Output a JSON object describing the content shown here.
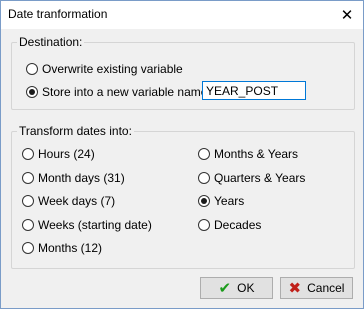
{
  "window": {
    "title": "Date tranformation"
  },
  "destination": {
    "legend": "Destination:",
    "overwrite_label": "Overwrite existing variable",
    "store_new_label": "Store into a new variable named:",
    "new_variable_value": "YEAR_POST",
    "selected": "store_new"
  },
  "transform": {
    "legend": "Transform dates into:",
    "left_options": [
      "Hours (24)",
      "Month days (31)",
      "Week days (7)",
      "Weeks (starting date)",
      "Months (12)"
    ],
    "right_options": [
      "Months & Years",
      "Quarters & Years",
      "Years",
      "Decades"
    ],
    "selected": "Years"
  },
  "buttons": {
    "ok_label": "OK",
    "cancel_label": "Cancel",
    "ok_icon_color": "#1a9b1a",
    "cancel_icon_color": "#c0201a"
  },
  "icons": {
    "close": "close-icon",
    "ok": "checkmark-icon",
    "cancel": "x-icon"
  }
}
